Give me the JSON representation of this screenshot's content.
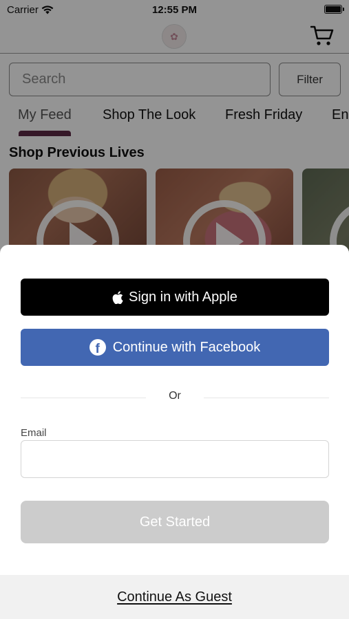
{
  "status_bar": {
    "carrier": "Carrier",
    "time": "12:55 PM"
  },
  "header": {
    "logo_icon": "boutique-logo",
    "cart_icon": "shopping-cart-icon"
  },
  "search": {
    "placeholder": "Search",
    "value": "",
    "filter_label": "Filter"
  },
  "tabs": [
    {
      "label": "My Feed",
      "selected": true
    },
    {
      "label": "Shop The Look",
      "selected": false
    },
    {
      "label": "Fresh Friday",
      "selected": false
    },
    {
      "label": "Ene",
      "selected": false
    }
  ],
  "section": {
    "title": "Shop Previous Lives"
  },
  "login_sheet": {
    "apple_label": "Sign in with Apple",
    "facebook_label": "Continue with Facebook",
    "or_label": "Or",
    "email_label": "Email",
    "email_value": "",
    "get_started_label": "Get Started",
    "guest_label": "Continue As Guest"
  },
  "colors": {
    "tab_indicator": "#5c2a45",
    "facebook_blue": "#4267b2",
    "apple_black": "#000000",
    "disabled_button": "#cccccc"
  }
}
